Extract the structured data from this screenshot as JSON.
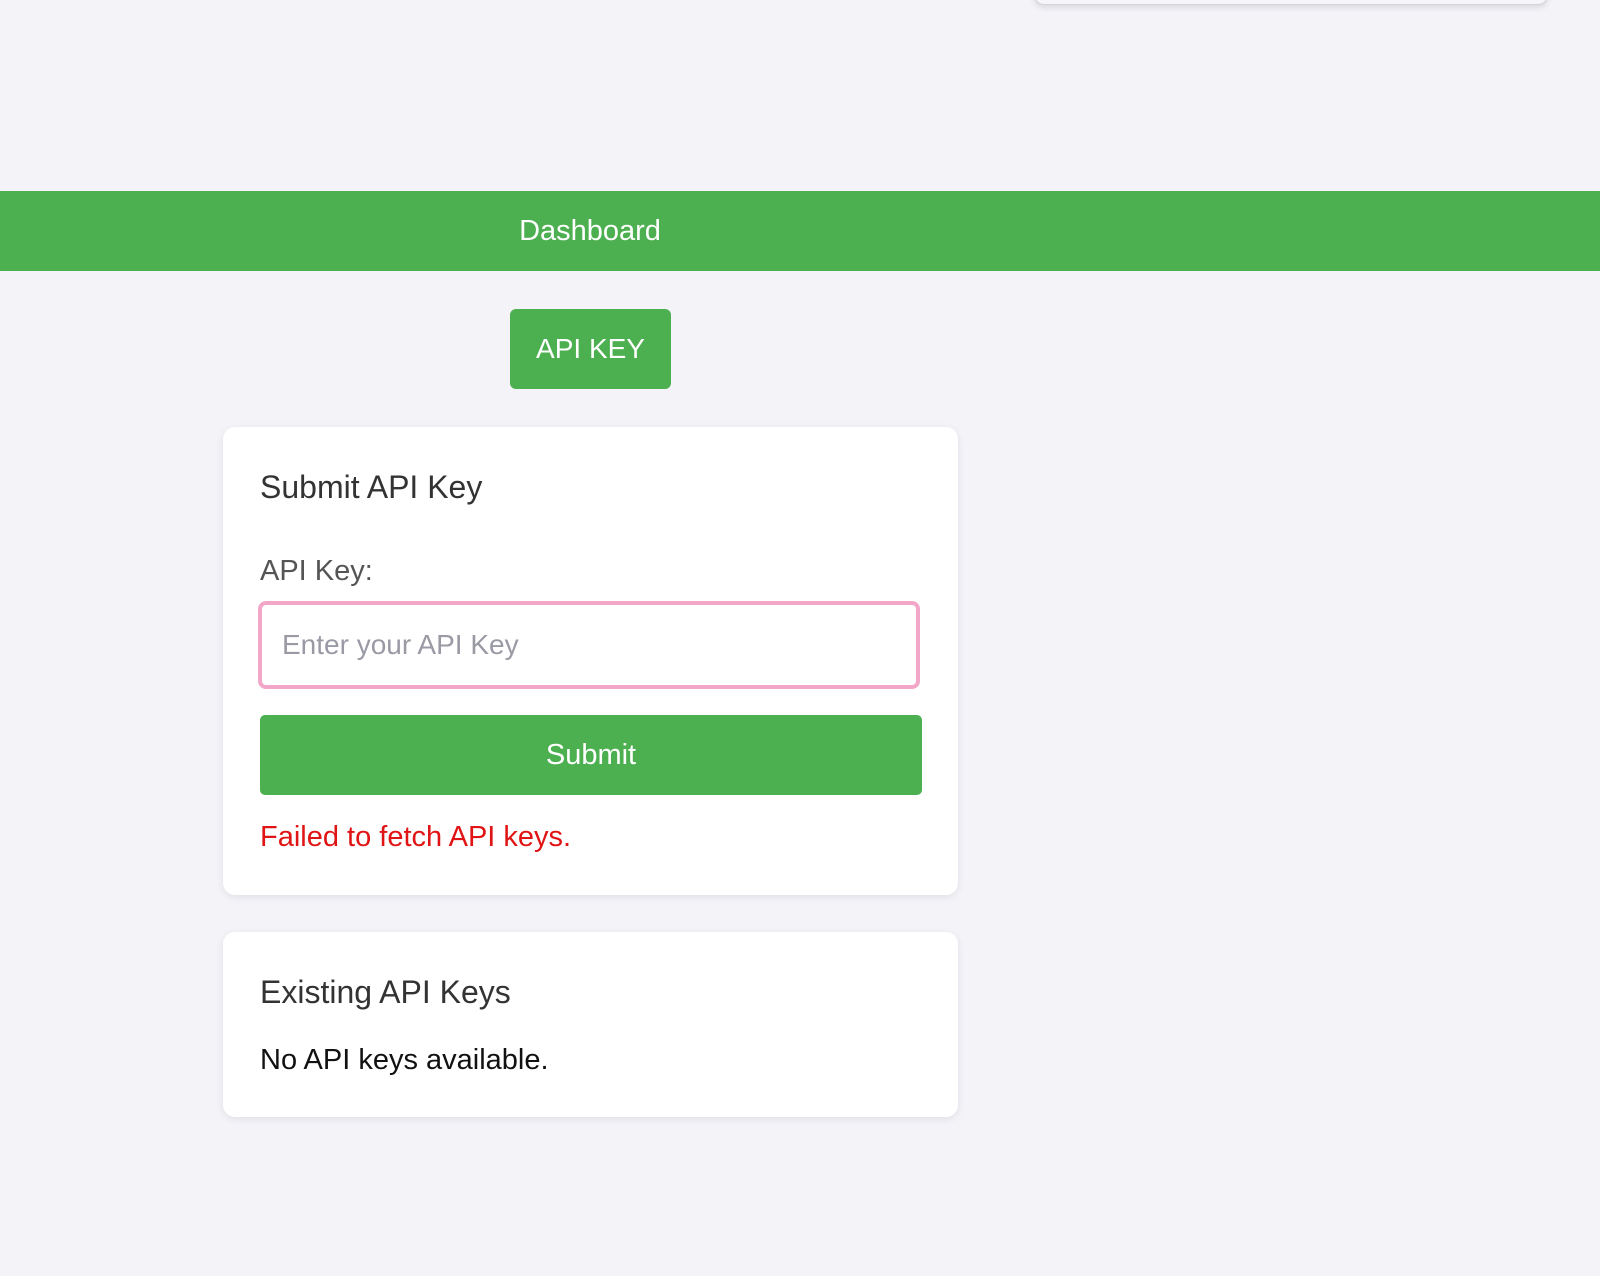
{
  "header": {
    "title": "Dashboard"
  },
  "tabs": {
    "api_key_label": "API KEY"
  },
  "submit_card": {
    "title": "Submit API Key",
    "field_label": "API Key:",
    "input_value": "",
    "input_placeholder": "Enter your API Key",
    "submit_label": "Submit",
    "error_message": "Failed to fetch API keys."
  },
  "existing_card": {
    "title": "Existing API Keys",
    "empty_message": "No API keys available."
  },
  "colors": {
    "accent": "#4caf50",
    "error": "#e01414",
    "input_focus_border": "#f2a7c8",
    "background": "#f3f3f8"
  }
}
